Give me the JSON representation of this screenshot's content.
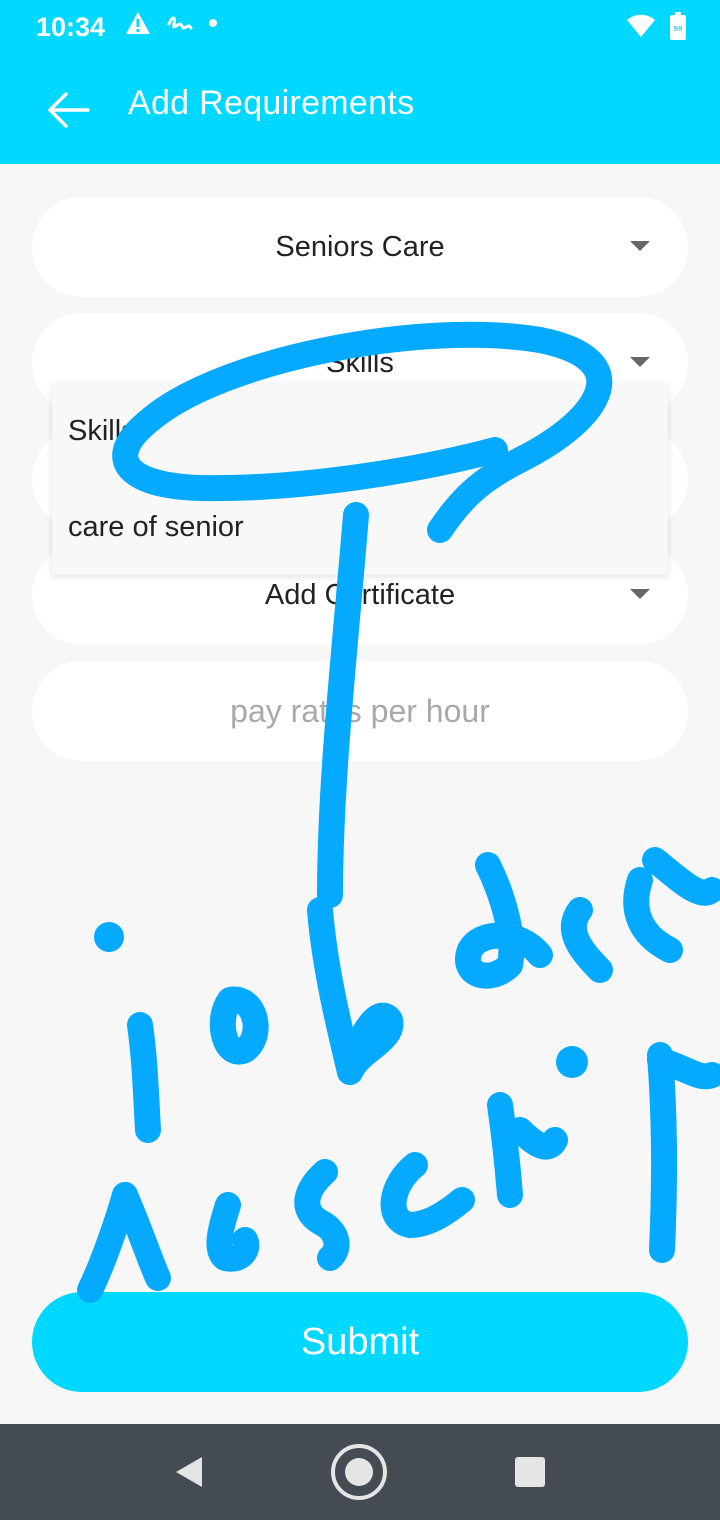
{
  "status_bar": {
    "time": "10:34",
    "left_icons": [
      "warning-icon",
      "signature-icon",
      "dot-icon"
    ],
    "right_icons": [
      "wifi-icon",
      "battery-icon"
    ],
    "battery_level": "98"
  },
  "app_bar": {
    "back_icon": "back-arrow-icon",
    "title": "Add Requirements"
  },
  "form": {
    "service_dropdown": {
      "value": "Seniors Care"
    },
    "skills_dropdown": {
      "value": "Skills"
    },
    "skills_menu": {
      "options": [
        "Skills",
        "care of senior"
      ]
    },
    "certificate_dropdown": {
      "value": "Add Certificate"
    },
    "pay_rate_input": {
      "placeholder": "pay rates per hour"
    }
  },
  "submit_label": "Submit",
  "nav_bar": {
    "icons": [
      "back-triangle-icon",
      "home-circle-icon",
      "recents-square-icon"
    ]
  },
  "colors": {
    "primary": "#00d8ff",
    "background": "#f7f7f7",
    "nav_bar": "#454b52",
    "annotation_ink": "#05aaff"
  }
}
